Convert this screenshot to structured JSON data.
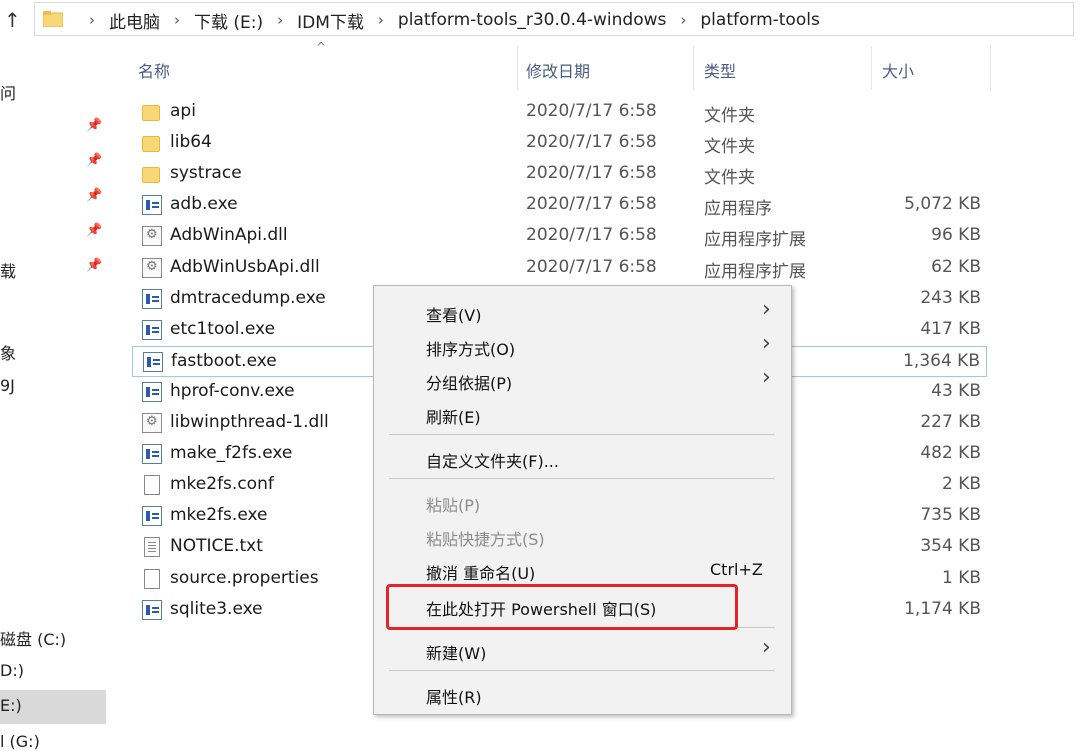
{
  "address": {
    "crumbs": [
      "此电脑",
      "下载 (E:)",
      "IDM下载",
      "platform-tools_r30.0.4-windows",
      "platform-tools"
    ]
  },
  "nav": {
    "fragments": [
      "问",
      "载",
      "象",
      "9J"
    ],
    "drives": [
      "磁盘 (C:)",
      "D:)",
      "E:)",
      "l (G:)"
    ]
  },
  "columns": {
    "name": "名称",
    "date": "修改日期",
    "type": "类型",
    "size": "大小"
  },
  "files": [
    {
      "icon": "folder",
      "name": "api",
      "date": "2020/7/17 6:58",
      "type": "文件夹",
      "size": ""
    },
    {
      "icon": "folder",
      "name": "lib64",
      "date": "2020/7/17 6:58",
      "type": "文件夹",
      "size": ""
    },
    {
      "icon": "folder",
      "name": "systrace",
      "date": "2020/7/17 6:58",
      "type": "文件夹",
      "size": ""
    },
    {
      "icon": "exe",
      "name": "adb.exe",
      "date": "2020/7/17 6:58",
      "type": "应用程序",
      "size": "5,072 KB"
    },
    {
      "icon": "dll",
      "name": "AdbWinApi.dll",
      "date": "2020/7/17 6:58",
      "type": "应用程序扩展",
      "size": "96 KB"
    },
    {
      "icon": "dll",
      "name": "AdbWinUsbApi.dll",
      "date": "2020/7/17 6:58",
      "type": "应用程序扩展",
      "size": "62 KB"
    },
    {
      "icon": "exe",
      "name": "dmtracedump.exe",
      "date": "",
      "type": "",
      "size": "243 KB"
    },
    {
      "icon": "exe",
      "name": "etc1tool.exe",
      "date": "",
      "type": "",
      "size": "417 KB"
    },
    {
      "icon": "exe",
      "name": "fastboot.exe",
      "date": "",
      "type": "",
      "size": "1,364 KB",
      "selected": true
    },
    {
      "icon": "exe",
      "name": "hprof-conv.exe",
      "date": "",
      "type": "",
      "size": "43 KB"
    },
    {
      "icon": "dll",
      "name": "libwinpthread-1.dll",
      "date": "",
      "type": "展",
      "size": "227 KB"
    },
    {
      "icon": "exe",
      "name": "make_f2fs.exe",
      "date": "",
      "type": "",
      "size": "482 KB"
    },
    {
      "icon": "file",
      "name": "mke2fs.conf",
      "date": "",
      "type": "",
      "size": "2 KB"
    },
    {
      "icon": "exe",
      "name": "mke2fs.exe",
      "date": "",
      "type": "",
      "size": "735 KB"
    },
    {
      "icon": "txt",
      "name": "NOTICE.txt",
      "date": "",
      "type": "",
      "size": "354 KB"
    },
    {
      "icon": "file",
      "name": "source.properties",
      "date": "",
      "type": "ES 文件",
      "size": "1 KB"
    },
    {
      "icon": "exe",
      "name": "sqlite3.exe",
      "date": "",
      "type": "",
      "size": "1,174 KB"
    }
  ],
  "context_menu": {
    "items": [
      {
        "label": "查看(V)",
        "submenu": true
      },
      {
        "label": "排序方式(O)",
        "submenu": true
      },
      {
        "label": "分组依据(P)",
        "submenu": true
      },
      {
        "label": "刷新(E)"
      },
      {
        "label": "自定义文件夹(F)..."
      },
      {
        "label": "粘贴(P)",
        "disabled": true
      },
      {
        "label": "粘贴快捷方式(S)",
        "disabled": true
      },
      {
        "label": "撤消 重命名(U)",
        "shortcut": "Ctrl+Z"
      },
      {
        "label": "在此处打开 Powershell 窗口(S)",
        "highlighted": true
      },
      {
        "label": "新建(W)",
        "submenu": true
      },
      {
        "label": "属性(R)"
      }
    ],
    "highlight_color": "#e0242a"
  }
}
